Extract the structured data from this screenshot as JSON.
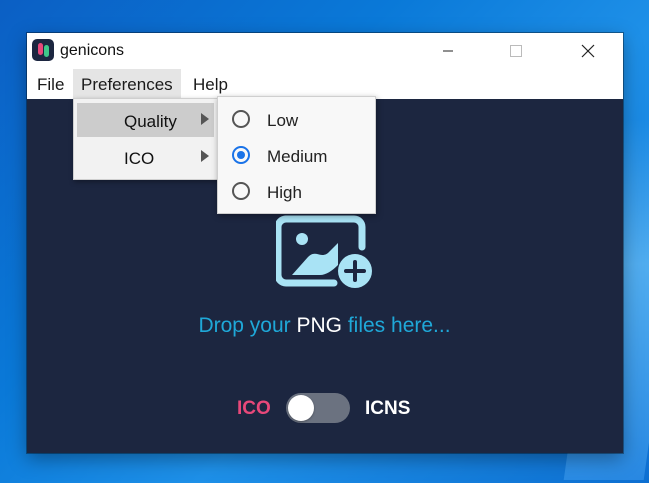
{
  "app": {
    "title": "genicons",
    "icon": "genicons-logo-icon"
  },
  "window_controls": {
    "minimize": "minimize-icon",
    "maximize": "maximize-icon",
    "close": "close-icon"
  },
  "menubar": {
    "items": [
      {
        "label": "File"
      },
      {
        "label": "Preferences",
        "open": true
      },
      {
        "label": "Help"
      }
    ]
  },
  "preferences_menu": {
    "items": [
      {
        "label": "Quality",
        "highlighted": true,
        "has_submenu": true
      },
      {
        "label": "ICO",
        "highlighted": false,
        "has_submenu": true
      }
    ]
  },
  "quality_submenu": {
    "options": [
      {
        "label": "Low",
        "selected": false
      },
      {
        "label": "Medium",
        "selected": true
      },
      {
        "label": "High",
        "selected": false
      }
    ]
  },
  "dropzone": {
    "icon": "add-image-icon",
    "text_before": "Drop your ",
    "text_highlight": "PNG",
    "text_after": " files here..."
  },
  "format_toggle": {
    "left_label": "ICO",
    "right_label": "ICNS",
    "state": "ICO"
  },
  "colors": {
    "window_bg": "#1c2640",
    "accent_cyan": "#1fa8d8",
    "accent_pink": "#e8487a",
    "radio_blue": "#1a73e8"
  }
}
